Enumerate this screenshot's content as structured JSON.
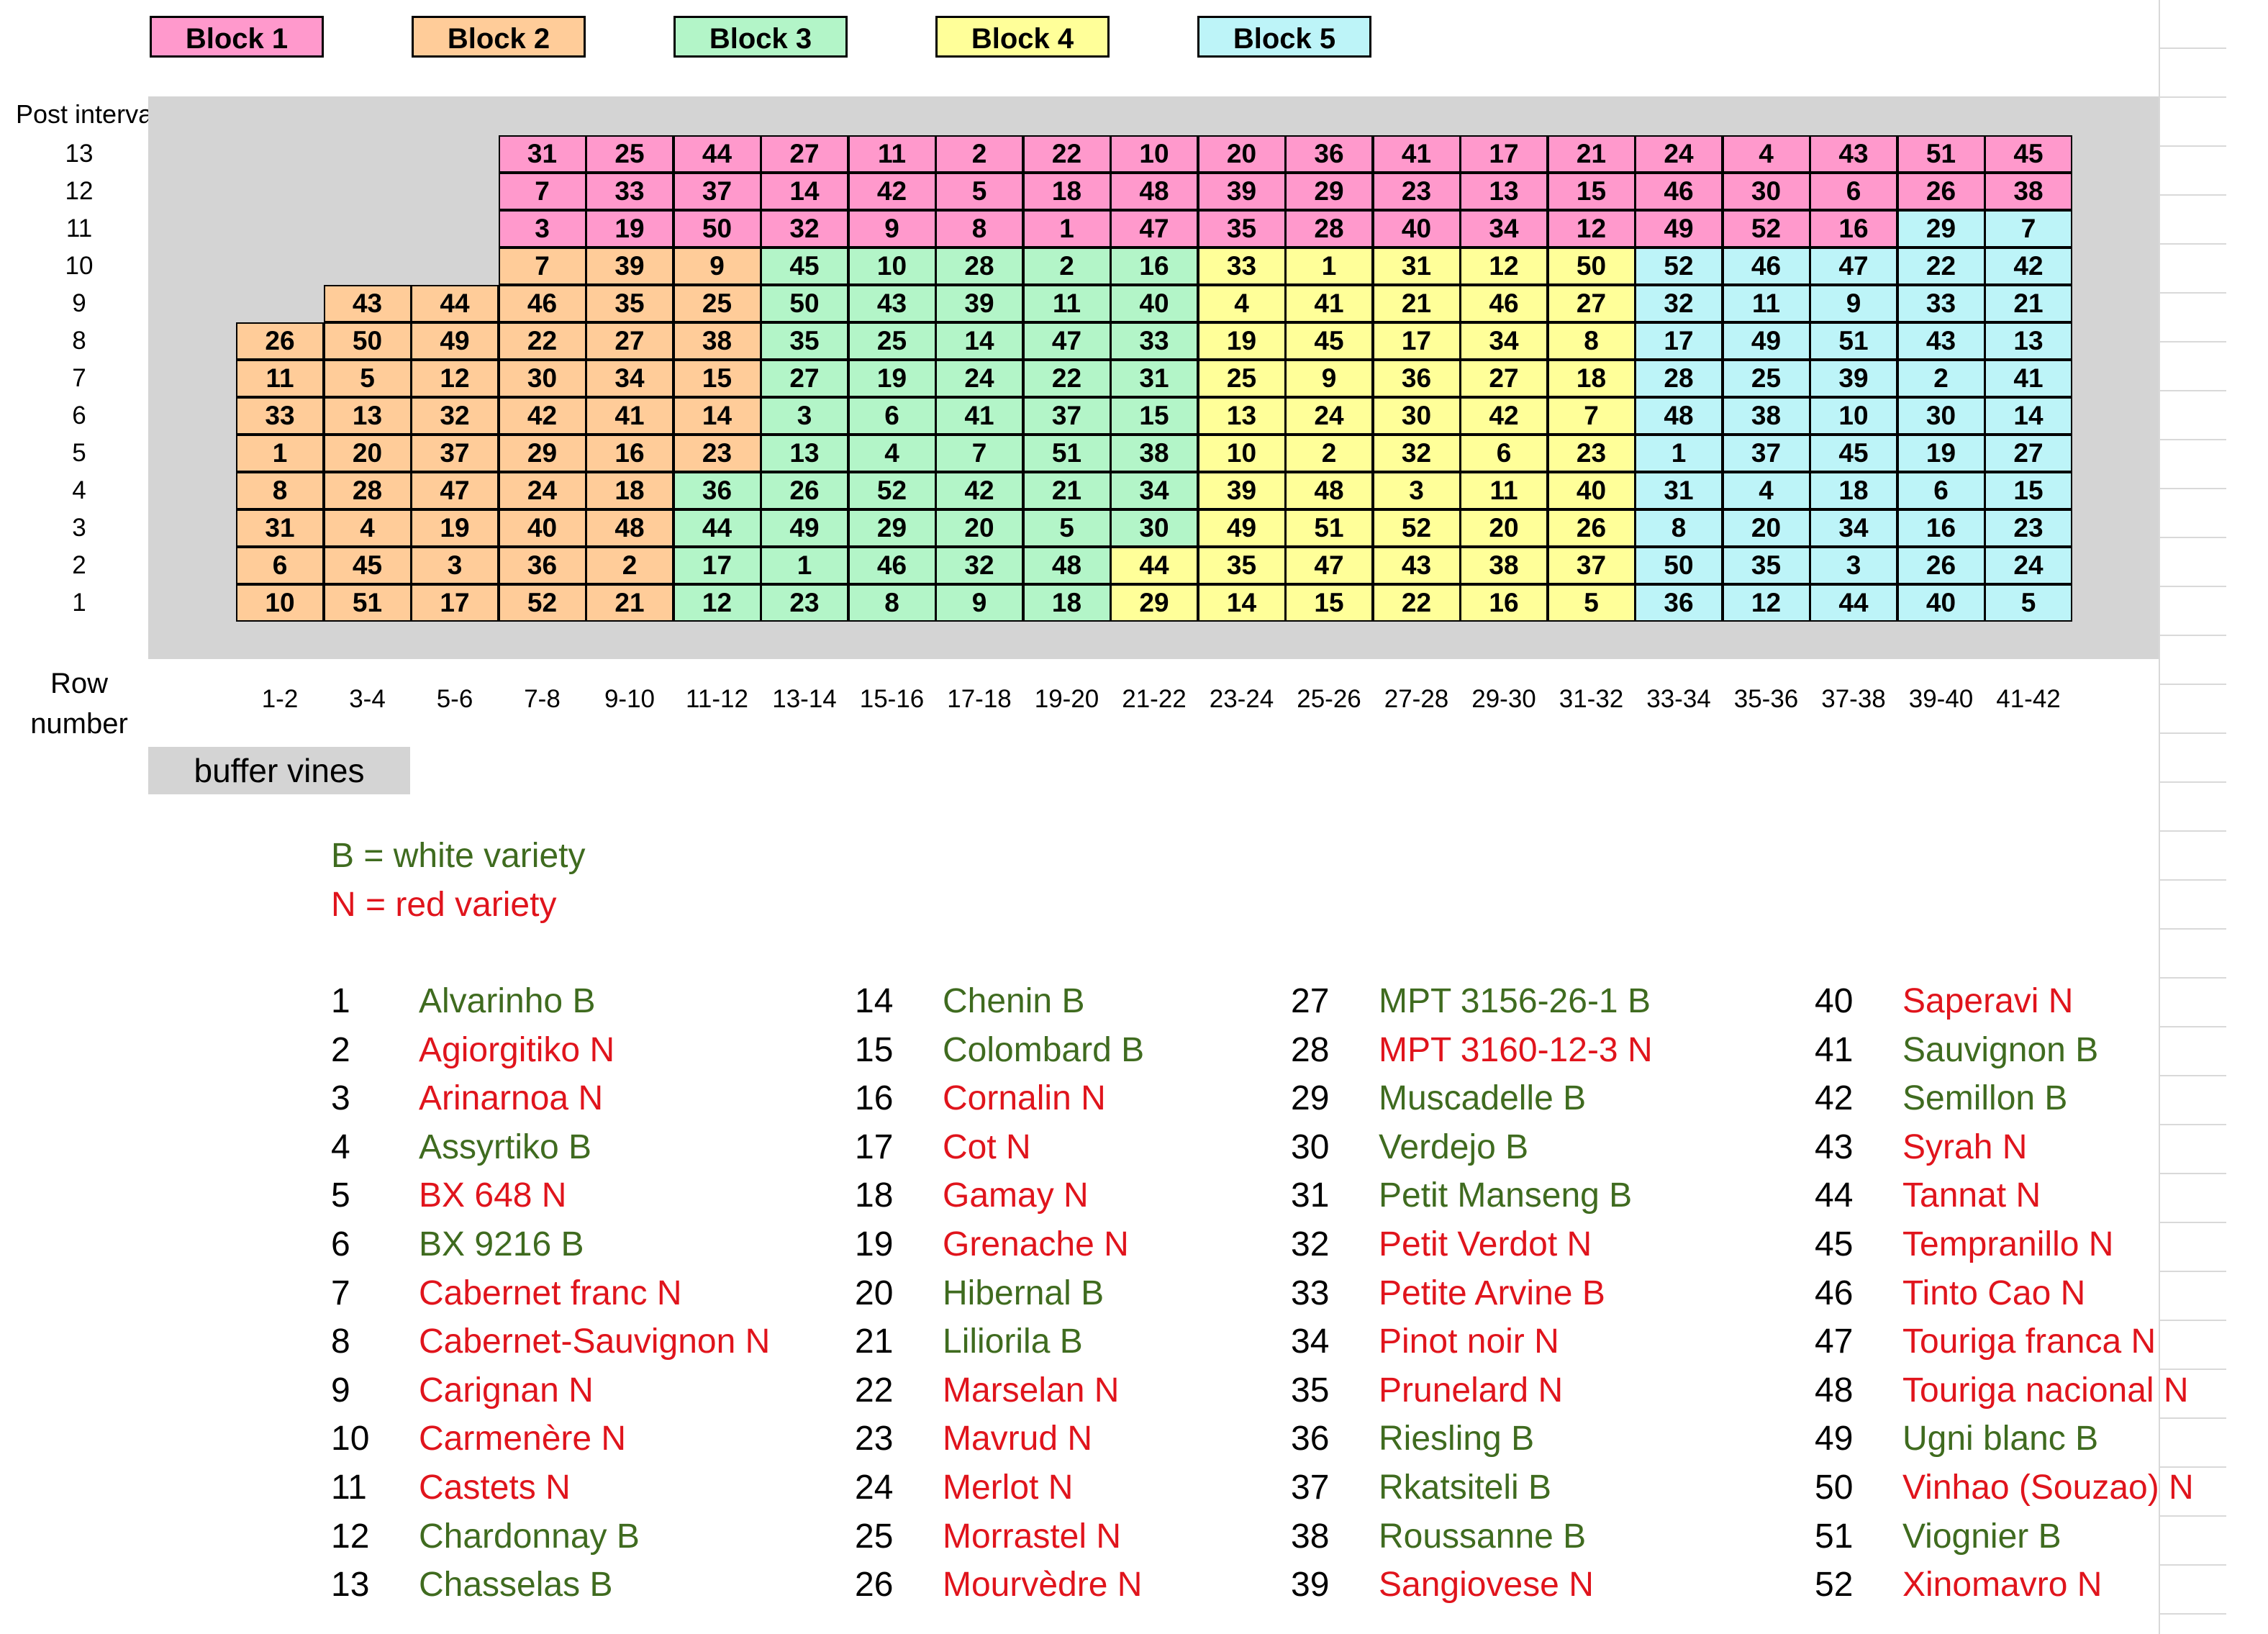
{
  "colors": {
    "block1": "#ff99cc",
    "block2": "#ffcc99",
    "block3": "#b3f5c8",
    "block4": "#ffff99",
    "block5": "#bdf4f8",
    "buffer": "#d4d4d4",
    "white_variety": "#3f6b1f",
    "red_variety": "#e0141c"
  },
  "legend": [
    {
      "label": "Block 1",
      "block": 1
    },
    {
      "label": "Block 2",
      "block": 2
    },
    {
      "label": "Block 3",
      "block": 3
    },
    {
      "label": "Block 4",
      "block": 4
    },
    {
      "label": "Block 5",
      "block": 5
    }
  ],
  "axis": {
    "post_interval_label": "Post interval",
    "row_number_label": "Row\nnumber",
    "post_intervals": [
      "13",
      "12",
      "11",
      "10",
      "9",
      "8",
      "7",
      "6",
      "5",
      "4",
      "3",
      "2",
      "1"
    ],
    "row_labels": [
      "1-2",
      "3-4",
      "5-6",
      "7-8",
      "9-10",
      "11-12",
      "13-14",
      "15-16",
      "17-18",
      "19-20",
      "21-22",
      "23-24",
      "25-26",
      "27-28",
      "29-30",
      "31-32",
      "33-34",
      "35-36",
      "37-38",
      "39-40",
      "41-42"
    ]
  },
  "grid": {
    "start_col": [
      3,
      3,
      3,
      3,
      1,
      0,
      0,
      0,
      0,
      0,
      0,
      0,
      0
    ],
    "values": [
      [
        31,
        25,
        44,
        27,
        11,
        2,
        22,
        10,
        20,
        36,
        41,
        17,
        21,
        24,
        4,
        43,
        51,
        45
      ],
      [
        7,
        33,
        37,
        14,
        42,
        5,
        18,
        48,
        39,
        29,
        23,
        13,
        15,
        46,
        30,
        6,
        26,
        38
      ],
      [
        3,
        19,
        50,
        32,
        9,
        8,
        1,
        47,
        35,
        28,
        40,
        34,
        12,
        49,
        52,
        16,
        29,
        7
      ],
      [
        7,
        39,
        9,
        45,
        10,
        28,
        2,
        16,
        33,
        1,
        31,
        12,
        50,
        52,
        46,
        47,
        22,
        42
      ],
      [
        43,
        44,
        46,
        35,
        25,
        50,
        43,
        39,
        11,
        40,
        4,
        41,
        21,
        46,
        27,
        32,
        11,
        9,
        33,
        21
      ],
      [
        26,
        50,
        49,
        22,
        27,
        38,
        35,
        25,
        14,
        47,
        33,
        19,
        45,
        17,
        34,
        8,
        17,
        49,
        51,
        43,
        13
      ],
      [
        11,
        5,
        12,
        30,
        34,
        15,
        27,
        19,
        24,
        22,
        31,
        25,
        9,
        36,
        27,
        18,
        28,
        25,
        39,
        2,
        41
      ],
      [
        33,
        13,
        32,
        42,
        41,
        14,
        3,
        6,
        41,
        37,
        15,
        13,
        24,
        30,
        42,
        7,
        48,
        38,
        10,
        30,
        14
      ],
      [
        1,
        20,
        37,
        29,
        16,
        23,
        13,
        4,
        7,
        51,
        38,
        10,
        2,
        32,
        6,
        23,
        1,
        37,
        45,
        19,
        27
      ],
      [
        8,
        28,
        47,
        24,
        18,
        36,
        26,
        52,
        42,
        21,
        34,
        39,
        48,
        3,
        11,
        40,
        31,
        4,
        18,
        6,
        15
      ],
      [
        31,
        4,
        19,
        40,
        48,
        44,
        49,
        29,
        20,
        5,
        30,
        49,
        51,
        52,
        20,
        26,
        8,
        20,
        34,
        16,
        23
      ],
      [
        6,
        45,
        3,
        36,
        2,
        17,
        1,
        46,
        32,
        48,
        44,
        35,
        47,
        43,
        38,
        37,
        50,
        35,
        3,
        26,
        24
      ],
      [
        10,
        51,
        17,
        52,
        21,
        12,
        23,
        8,
        9,
        18,
        29,
        14,
        15,
        22,
        16,
        5,
        36,
        12,
        44,
        40,
        5
      ]
    ],
    "blocks": [
      [
        1,
        1,
        1,
        1,
        1,
        1,
        1,
        1,
        1,
        1,
        1,
        1,
        1,
        1,
        1,
        1,
        1,
        1
      ],
      [
        1,
        1,
        1,
        1,
        1,
        1,
        1,
        1,
        1,
        1,
        1,
        1,
        1,
        1,
        1,
        1,
        1,
        1
      ],
      [
        1,
        1,
        1,
        1,
        1,
        1,
        1,
        1,
        1,
        1,
        1,
        1,
        1,
        1,
        1,
        1,
        5,
        5
      ],
      [
        2,
        2,
        2,
        3,
        3,
        3,
        3,
        3,
        4,
        4,
        4,
        4,
        4,
        5,
        5,
        5,
        5,
        5
      ],
      [
        2,
        2,
        2,
        2,
        2,
        3,
        3,
        3,
        3,
        3,
        4,
        4,
        4,
        4,
        4,
        5,
        5,
        5,
        5,
        5
      ],
      [
        2,
        2,
        2,
        2,
        2,
        2,
        3,
        3,
        3,
        3,
        3,
        4,
        4,
        4,
        4,
        4,
        5,
        5,
        5,
        5,
        5
      ],
      [
        2,
        2,
        2,
        2,
        2,
        2,
        3,
        3,
        3,
        3,
        3,
        4,
        4,
        4,
        4,
        4,
        5,
        5,
        5,
        5,
        5
      ],
      [
        2,
        2,
        2,
        2,
        2,
        2,
        3,
        3,
        3,
        3,
        3,
        4,
        4,
        4,
        4,
        4,
        5,
        5,
        5,
        5,
        5
      ],
      [
        2,
        2,
        2,
        2,
        2,
        2,
        3,
        3,
        3,
        3,
        3,
        4,
        4,
        4,
        4,
        4,
        5,
        5,
        5,
        5,
        5
      ],
      [
        2,
        2,
        2,
        2,
        2,
        3,
        3,
        3,
        3,
        3,
        3,
        4,
        4,
        4,
        4,
        4,
        5,
        5,
        5,
        5,
        5
      ],
      [
        2,
        2,
        2,
        2,
        2,
        3,
        3,
        3,
        3,
        3,
        3,
        4,
        4,
        4,
        4,
        4,
        5,
        5,
        5,
        5,
        5
      ],
      [
        2,
        2,
        2,
        2,
        2,
        3,
        3,
        3,
        3,
        3,
        4,
        4,
        4,
        4,
        4,
        4,
        5,
        5,
        5,
        5,
        5
      ],
      [
        2,
        2,
        2,
        2,
        2,
        3,
        3,
        3,
        3,
        3,
        4,
        4,
        4,
        4,
        4,
        4,
        5,
        5,
        5,
        5,
        5
      ]
    ]
  },
  "buffer_label": "buffer vines",
  "key": {
    "white": "B = white variety",
    "red": "N = red variety"
  },
  "varieties": [
    {
      "num": "1",
      "name": "Alvarinho B",
      "type": "white"
    },
    {
      "num": "2",
      "name": "Agiorgitiko N",
      "type": "red"
    },
    {
      "num": "3",
      "name": "Arinarnoa N",
      "type": "red"
    },
    {
      "num": "4",
      "name": "Assyrtiko B",
      "type": "white"
    },
    {
      "num": "5",
      "name": "BX 648 N",
      "type": "red"
    },
    {
      "num": "6",
      "name": "BX 9216 B",
      "type": "white"
    },
    {
      "num": "7",
      "name": "Cabernet franc N",
      "type": "red"
    },
    {
      "num": "8",
      "name": "Cabernet-Sauvignon N",
      "type": "red"
    },
    {
      "num": "9",
      "name": "Carignan N",
      "type": "red"
    },
    {
      "num": "10",
      "name": "Carmenère N",
      "type": "red"
    },
    {
      "num": "11",
      "name": "Castets N",
      "type": "red"
    },
    {
      "num": "12",
      "name": "Chardonnay B",
      "type": "white"
    },
    {
      "num": "13",
      "name": "Chasselas B",
      "type": "white"
    },
    {
      "num": "14",
      "name": "Chenin B",
      "type": "white"
    },
    {
      "num": "15",
      "name": "Colombard B",
      "type": "white"
    },
    {
      "num": "16",
      "name": "Cornalin N",
      "type": "red"
    },
    {
      "num": "17",
      "name": "Cot N",
      "type": "red"
    },
    {
      "num": "18",
      "name": "Gamay N",
      "type": "red"
    },
    {
      "num": "19",
      "name": "Grenache N",
      "type": "red"
    },
    {
      "num": "20",
      "name": "Hibernal B",
      "type": "white"
    },
    {
      "num": "21",
      "name": "Liliorila B",
      "type": "white"
    },
    {
      "num": "22",
      "name": "Marselan N",
      "type": "red"
    },
    {
      "num": "23",
      "name": "Mavrud N",
      "type": "red"
    },
    {
      "num": "24",
      "name": "Merlot N",
      "type": "red"
    },
    {
      "num": "25",
      "name": "Morrastel N",
      "type": "red"
    },
    {
      "num": "26",
      "name": "Mourvèdre N",
      "type": "red"
    },
    {
      "num": "27",
      "name": "MPT 3156-26-1 B",
      "type": "white"
    },
    {
      "num": "28",
      "name": "MPT 3160-12-3 N",
      "type": "red"
    },
    {
      "num": "29",
      "name": "Muscadelle B",
      "type": "white"
    },
    {
      "num": "30",
      "name": "Verdejo B",
      "type": "white"
    },
    {
      "num": "31",
      "name": "Petit Manseng B",
      "type": "white"
    },
    {
      "num": "32",
      "name": "Petit Verdot N",
      "type": "red"
    },
    {
      "num": "33",
      "name": "Petite Arvine B",
      "type": "red"
    },
    {
      "num": "34",
      "name": "Pinot noir N",
      "type": "red"
    },
    {
      "num": "35",
      "name": "Prunelard N",
      "type": "red"
    },
    {
      "num": "36",
      "name": "Riesling B",
      "type": "white"
    },
    {
      "num": "37",
      "name": "Rkatsiteli B",
      "type": "white"
    },
    {
      "num": "38",
      "name": "Roussanne B",
      "type": "white"
    },
    {
      "num": "39",
      "name": "Sangiovese N",
      "type": "red"
    },
    {
      "num": "40",
      "name": "Saperavi N",
      "type": "red"
    },
    {
      "num": "41",
      "name": "Sauvignon B",
      "type": "white"
    },
    {
      "num": "42",
      "name": "Semillon B",
      "type": "white"
    },
    {
      "num": "43",
      "name": "Syrah N",
      "type": "red"
    },
    {
      "num": "44",
      "name": "Tannat N",
      "type": "red"
    },
    {
      "num": "45",
      "name": "Tempranillo N",
      "type": "red"
    },
    {
      "num": "46",
      "name": "Tinto Cao N",
      "type": "red"
    },
    {
      "num": "47",
      "name": "Touriga franca N",
      "type": "red"
    },
    {
      "num": "48",
      "name": "Touriga nacional N",
      "type": "red"
    },
    {
      "num": "49",
      "name": "Ugni blanc B",
      "type": "white"
    },
    {
      "num": "50",
      "name": "Vinhao (Souzao) N",
      "type": "red"
    },
    {
      "num": "51",
      "name": "Viognier B",
      "type": "white"
    },
    {
      "num": "52",
      "name": "Xinomavro N",
      "type": "red"
    }
  ]
}
